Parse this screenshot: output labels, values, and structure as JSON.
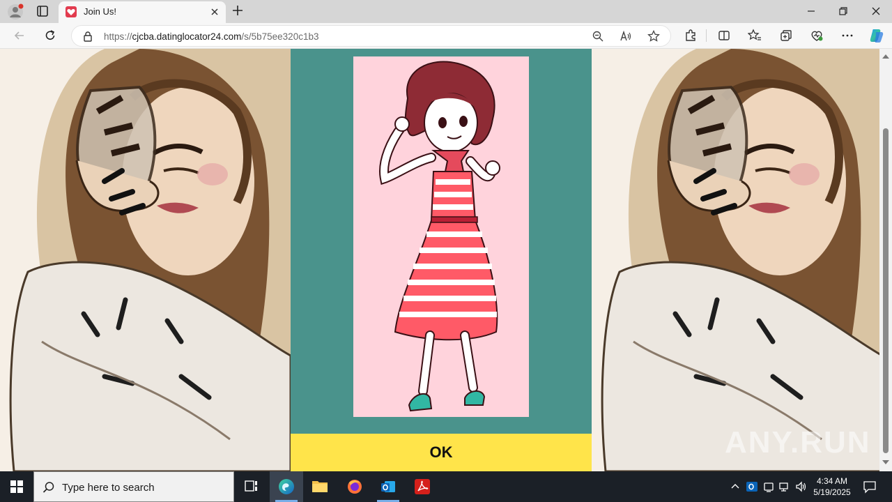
{
  "browser": {
    "tab": {
      "title": "Join Us!"
    },
    "address": {
      "scheme": "https://",
      "host": "cjcba.datinglocator24.com",
      "path": "/s/5b75ee320c1b3"
    }
  },
  "page": {
    "ok_label": "OK",
    "watermark": "ANY.RUN"
  },
  "taskbar": {
    "search_placeholder": "Type here to search",
    "time": "4:34 AM",
    "date": "5/19/2025"
  },
  "colors": {
    "panel": "#4a938c",
    "card": "#ffd3dc",
    "ok_button": "#ffe44a",
    "taskbar": "#1b2027"
  },
  "icons": {
    "profile": "profile-icon",
    "tab_favicon": "heart-favicon-icon",
    "lock": "lock-icon",
    "zoom": "zoom-icon",
    "read_aloud": "read-aloud-icon",
    "favorite": "star-icon"
  }
}
